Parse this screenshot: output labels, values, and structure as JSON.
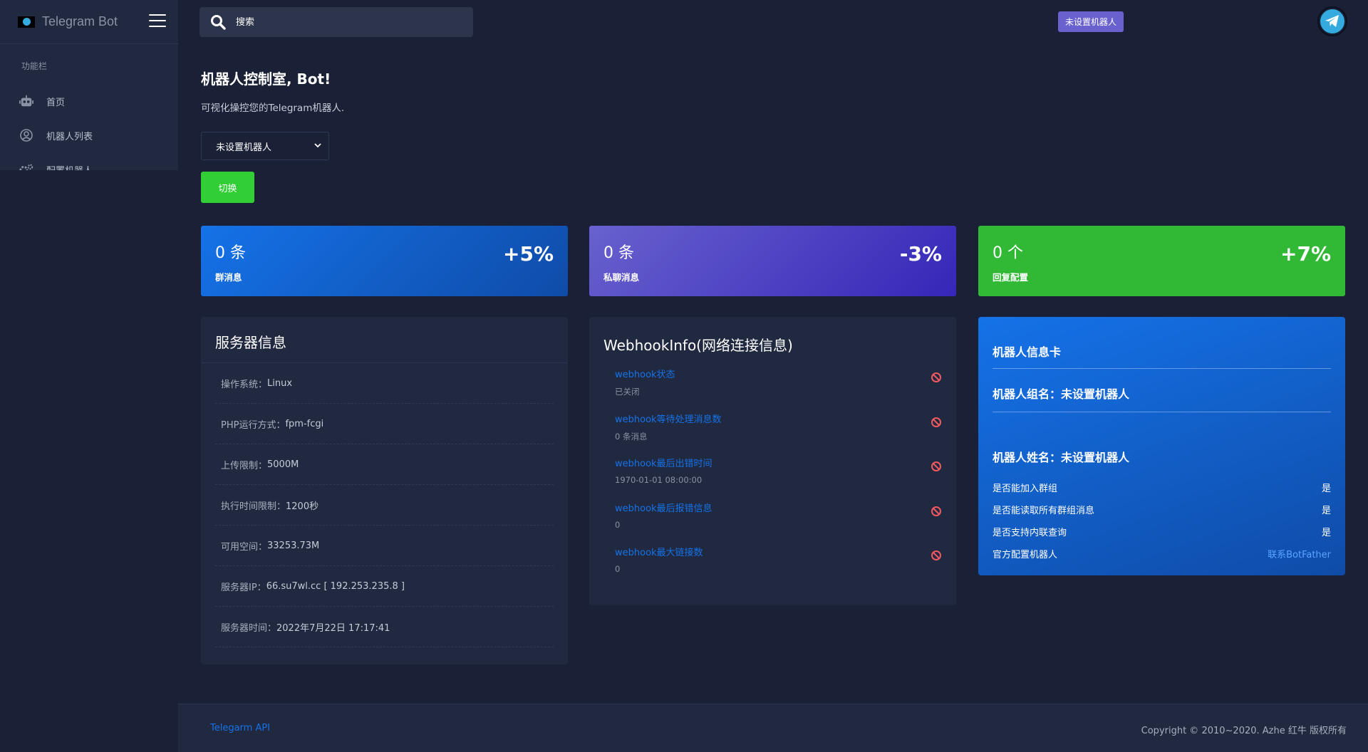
{
  "brand": {
    "name": "Telegram Bot"
  },
  "sidebar": {
    "section_label": "功能栏",
    "items": [
      {
        "label": "首页",
        "icon": "robot-icon"
      },
      {
        "label": "机器人列表",
        "icon": "user-circle-icon"
      },
      {
        "label": "配置机器人",
        "icon": "gears-icon"
      }
    ]
  },
  "search": {
    "placeholder": "搜索"
  },
  "topbar": {
    "badge": "未设置机器人"
  },
  "main": {
    "title": "机器人控制室, Bot!",
    "subtitle": "可视化操控您的Telegram机器人.",
    "select_value": "未设置机器人",
    "switch_label": "切换"
  },
  "stats": [
    {
      "num": "0 条",
      "label": "群消息",
      "pct": "+5%"
    },
    {
      "num": "0 条",
      "label": "私聊消息",
      "pct": "-3%"
    },
    {
      "num": "0 个",
      "label": "回复配置",
      "pct": "+7%"
    }
  ],
  "server": {
    "title": "服务器信息",
    "items": [
      {
        "k": "操作系统：",
        "v": "Linux"
      },
      {
        "k": "PHP运行方式：",
        "v": "fpm-fcgi"
      },
      {
        "k": "上传限制：",
        "v": "5000M"
      },
      {
        "k": "执行时间限制：",
        "v": "1200秒"
      },
      {
        "k": "可用空间：",
        "v": "33253.73M"
      },
      {
        "k": "服务器IP：",
        "v": "66.su7wl.cc [ 192.253.235.8 ]"
      },
      {
        "k": "服务器时间：",
        "v": "2022年7月22日 17:17:41"
      }
    ]
  },
  "webhook": {
    "title": "WebhookInfo(网络连接信息)",
    "items": [
      {
        "k": "webhook状态",
        "v": "已关闭"
      },
      {
        "k": "webhook等待处理消息数",
        "v": "0 条消息"
      },
      {
        "k": "webhook最后出错时间",
        "v": "1970-01-01 08:00:00"
      },
      {
        "k": "webhook最后报错信息",
        "v": "0"
      },
      {
        "k": "webhook最大链接数",
        "v": "0"
      }
    ]
  },
  "botinfo": {
    "title": "机器人信息卡",
    "group_name": "机器人组名：未设置机器人",
    "bot_name": "机器人姓名：未设置机器人",
    "rows": [
      {
        "k": "是否能加入群组",
        "v": "是"
      },
      {
        "k": "是否能读取所有群组消息",
        "v": "是"
      },
      {
        "k": "是否支持内联查询",
        "v": "是"
      },
      {
        "k": "官方配置机器人",
        "v": "联系BotFather"
      }
    ]
  },
  "footer": {
    "api": "Telegarm API",
    "copyright": "Copyright © 2010~2020. Azhe 红牛 版权所有"
  },
  "colors": {
    "bg": "#1a2035",
    "card": "#202940",
    "primary": "#1572e8",
    "secondary": "#6861ce",
    "success": "#31ce36",
    "danger": "#f25961"
  }
}
